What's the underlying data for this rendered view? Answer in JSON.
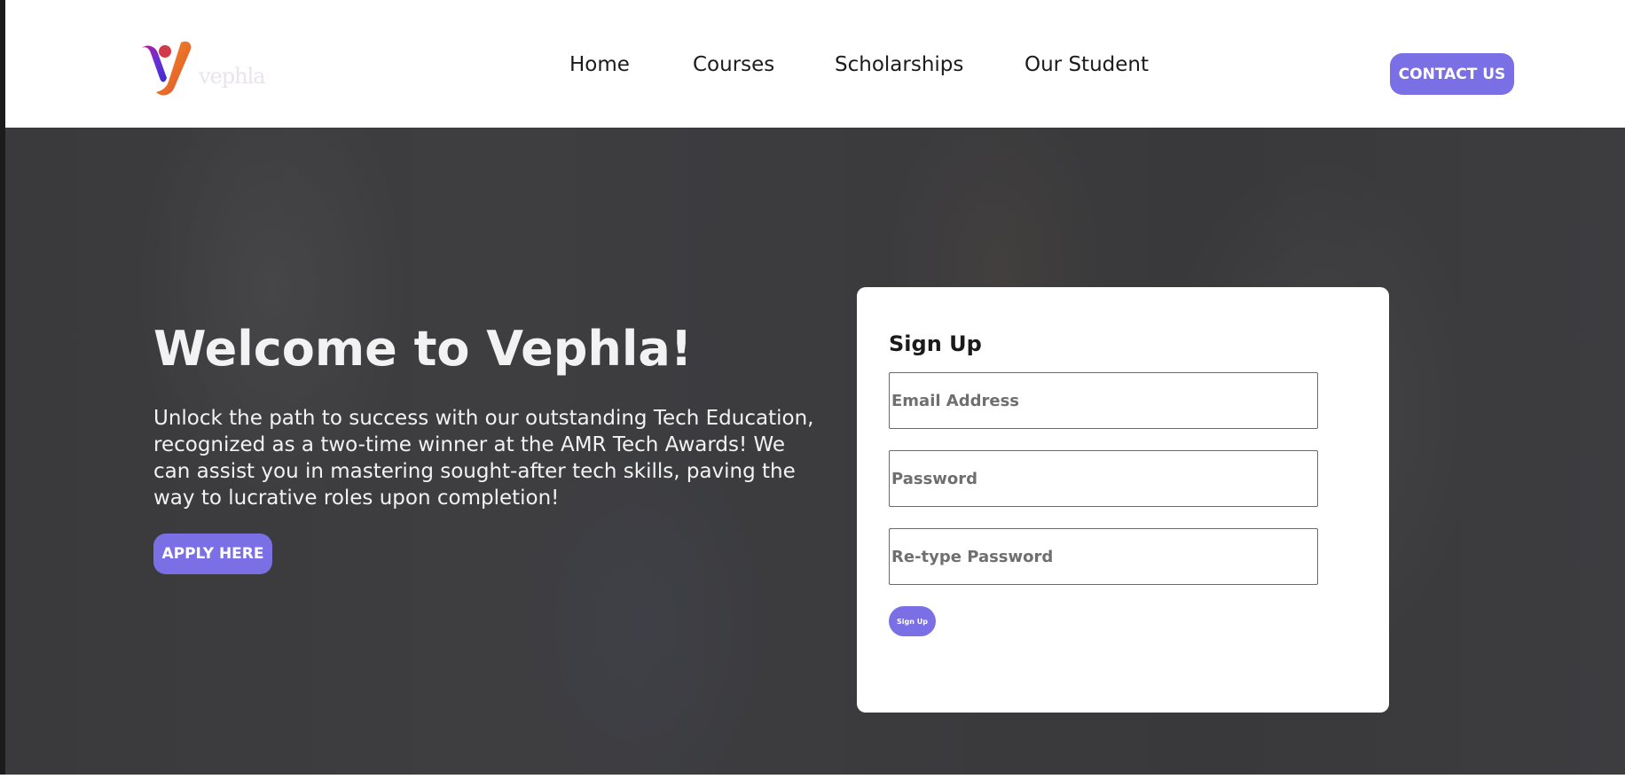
{
  "brand": {
    "logo_text": "vephla",
    "colors": {
      "accent": "#7b6fe6",
      "logo_orange": "#f07a2a",
      "logo_purple": "#6b2fd6",
      "logo_magenta": "#c2188f"
    }
  },
  "nav": {
    "items": [
      {
        "label": "Home"
      },
      {
        "label": "Courses"
      },
      {
        "label": "Scholarships"
      },
      {
        "label": "Our Student"
      }
    ],
    "contact_label": "CONTACT US"
  },
  "hero": {
    "title": "Welcome to Vephla!",
    "description": "Unlock the path to success with our outstanding Tech Education, recognized as a two-time winner at the AMR Tech Awards! We can assist you in mastering sought-after tech skills, paving the way to lucrative roles upon completion!",
    "apply_label": "APPLY HERE"
  },
  "signup": {
    "title": "Sign Up",
    "email_placeholder": "Email Address",
    "password_placeholder": "Password",
    "retype_placeholder": "Re-type Password",
    "button_label": "Sign Up"
  }
}
